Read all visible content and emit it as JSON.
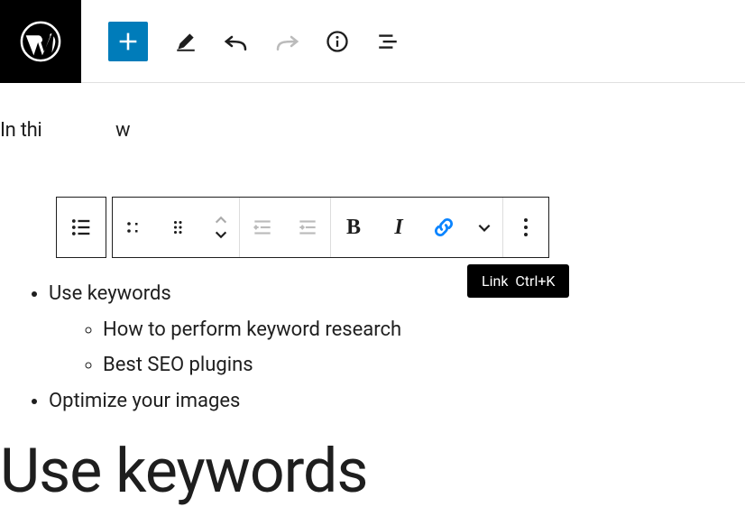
{
  "intro_fragment_left": "In thi",
  "intro_fragment_mid": "w",
  "tooltip": "Link  Ctrl+K",
  "list": {
    "item1": "Use keywords",
    "sub1": "How to perform keyword research",
    "sub2": "Best SEO plugins",
    "item2": "Optimize your images"
  },
  "heading": "Use keywords",
  "colors": {
    "accent": "#007cba",
    "link_active": "#0a84ff"
  }
}
